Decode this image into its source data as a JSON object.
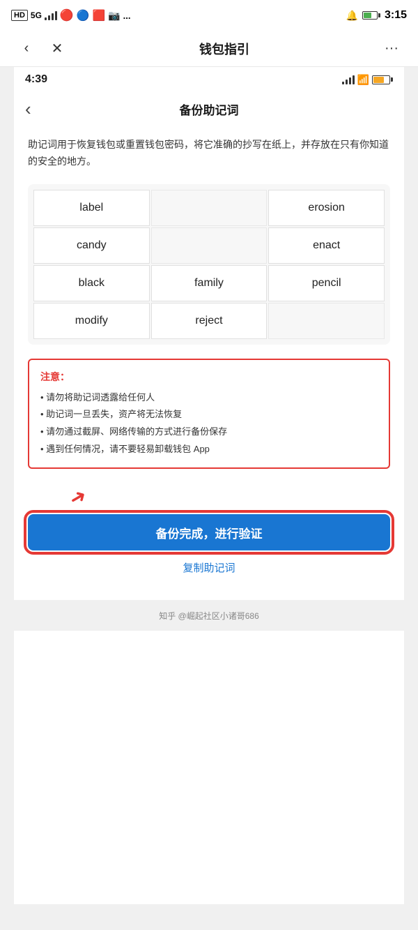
{
  "outer": {
    "status": {
      "left_text": "HD 5G",
      "time": "3:15",
      "more_dots": "..."
    },
    "nav": {
      "title": "钱包指引",
      "back_label": "‹",
      "close_label": "✕",
      "more_label": "···"
    }
  },
  "inner": {
    "status": {
      "time": "4:39"
    },
    "nav": {
      "back_label": "‹",
      "title": "备份助记词"
    },
    "description": "助记词用于恢复钱包或重置钱包密码，将它准确的抄写在纸上，并存放在只有你知道的安全的地方。",
    "mnemonic": {
      "words": [
        "label",
        "",
        "erosion",
        "candy",
        "",
        "enact",
        "black",
        "family",
        "pencil",
        "modify",
        "reject",
        ""
      ]
    },
    "warning": {
      "title": "注意：",
      "items": [
        "• 请勿将助记词透露给任何人",
        "• 助记词一旦丢失，资产将无法恢复",
        "• 请勿通过截屏、网络传输的方式进行备份保存",
        "• 遇到任何情况，请不要轻易卸载钱包 App"
      ]
    },
    "backup_button": "备份完成，进行验证",
    "copy_link": "复制助记词",
    "attribution": "知乎 @崛起社区小诸哥686"
  }
}
